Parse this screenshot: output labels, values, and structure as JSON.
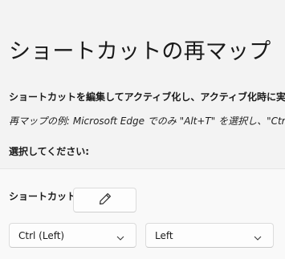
{
  "page": {
    "title": "ショートカットの再マップ",
    "description": "ショートカットを編集してアクティブ化し、アクティブ化時に実行す",
    "example": "再マップの例: Microsoft Edge でのみ \"Alt+T\" を選択し、\"Ctr",
    "select_label": "選択してください:"
  },
  "shortcut": {
    "label": "ショートカット:",
    "edit_icon": "pencil-icon"
  },
  "dropdowns": [
    {
      "value": "Ctrl (Left)",
      "icon": "chevron-down-icon"
    },
    {
      "value": "Left",
      "icon": "chevron-down-icon"
    }
  ],
  "colors": {
    "background": "#f3f3f3",
    "panel": "#f9f9f9",
    "control_bg": "#fdfdfd",
    "text": "#1a1a1a"
  }
}
